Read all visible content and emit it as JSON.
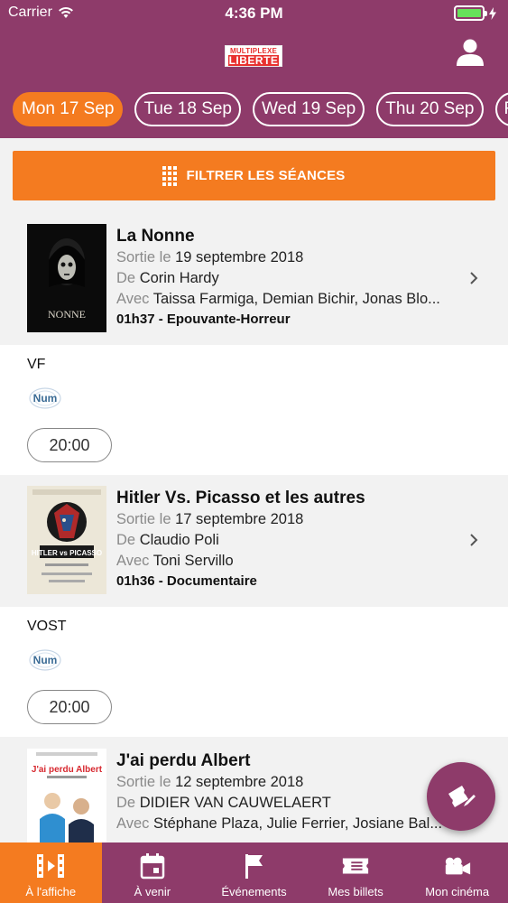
{
  "status_bar": {
    "carrier": "Carrier",
    "time": "4:36 PM"
  },
  "header": {
    "logo_top": "MULTIPLEXE",
    "logo_bottom": "LIBERTE",
    "user_icon": "user-icon",
    "brand_color": "#8e3b6a",
    "accent_color": "#f47b20"
  },
  "date_tabs": [
    {
      "label": "Mon 17 Sep",
      "active": true
    },
    {
      "label": "Tue 18 Sep",
      "active": false
    },
    {
      "label": "Wed 19 Sep",
      "active": false
    },
    {
      "label": "Thu 20 Sep",
      "active": false
    },
    {
      "label": "Fri",
      "active": false
    }
  ],
  "filter": {
    "label": "FILTRER LES SÉANCES",
    "icon": "grid-icon"
  },
  "labels": {
    "release": "Sortie le",
    "director": "De",
    "cast": "Avec"
  },
  "movies": [
    {
      "title": "La Nonne",
      "poster_text": "NONNE",
      "release_date": "19 septembre 2018",
      "director": "Corin Hardy",
      "cast": "Taissa Farmiga,  Demian Bichir,  Jonas Blo...",
      "meta": "01h37 - Epouvante-Horreur",
      "session": {
        "language": "VF",
        "format": "Num",
        "time": "20:00"
      }
    },
    {
      "title": "Hitler Vs. Picasso et les autres",
      "poster_text": "HITLER vs PICASSO",
      "release_date": "17 septembre 2018",
      "director": "Claudio Poli",
      "cast": "Toni Servillo",
      "meta": "01h36 - Documentaire",
      "session": {
        "language": "VOST",
        "format": "Num",
        "time": "20:00"
      }
    },
    {
      "title": "J'ai perdu Albert",
      "poster_text": "J'ai perdu Albert",
      "release_date": "12 septembre 2018",
      "director": "DIDIER VAN CAUWELAERT",
      "cast": "Stéphane Plaza,  Julie Ferrier,  Josiane Bal..."
    }
  ],
  "tabbar": [
    {
      "label": "À l'affiche",
      "icon": "film-icon",
      "active": true
    },
    {
      "label": "À venir",
      "icon": "calendar-icon",
      "active": false
    },
    {
      "label": "Événements",
      "icon": "flag-icon",
      "active": false
    },
    {
      "label": "Mes billets",
      "icon": "ticket-icon",
      "active": false
    },
    {
      "label": "Mon cinéma",
      "icon": "camera-icon",
      "active": false
    }
  ],
  "fab_icon": "ticket-edit-icon"
}
